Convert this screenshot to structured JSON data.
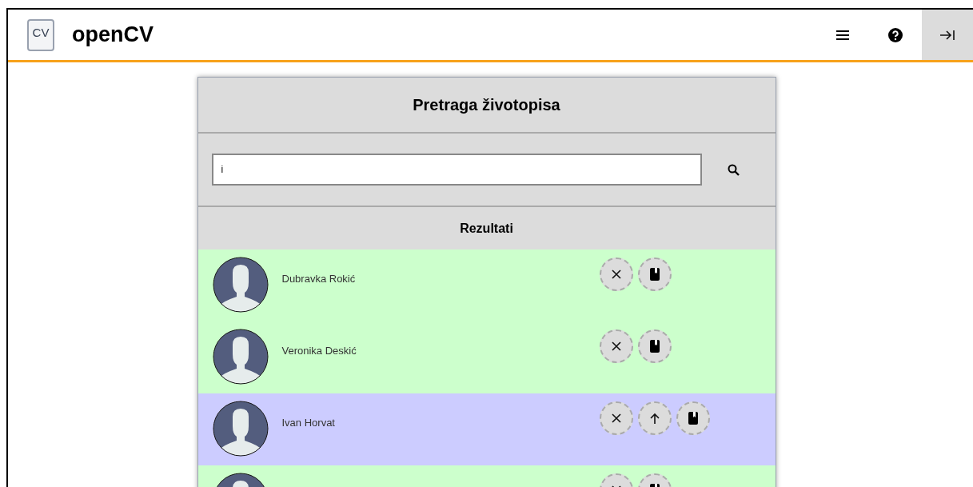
{
  "header": {
    "logo_text": "CV",
    "title": "openCV"
  },
  "card": {
    "title": "Pretraga životopisa",
    "search": {
      "value": "i"
    },
    "results_title": "Rezultati",
    "rows": [
      {
        "name": "Dubravka Rokić",
        "color": "#ccffcc",
        "actions": [
          {
            "kind": "remove"
          },
          {
            "kind": "book"
          }
        ]
      },
      {
        "name": "Veronika Deskić",
        "color": "#ccffcc",
        "actions": [
          {
            "kind": "remove"
          },
          {
            "kind": "book"
          }
        ]
      },
      {
        "name": "Ivan Horvat",
        "color": "#ccccff",
        "actions": [
          {
            "kind": "remove"
          },
          {
            "kind": "upload"
          },
          {
            "kind": "book"
          }
        ]
      },
      {
        "color": "#ccffcc",
        "actions": [
          {
            "kind": "remove"
          },
          {
            "kind": "book"
          }
        ]
      }
    ]
  }
}
